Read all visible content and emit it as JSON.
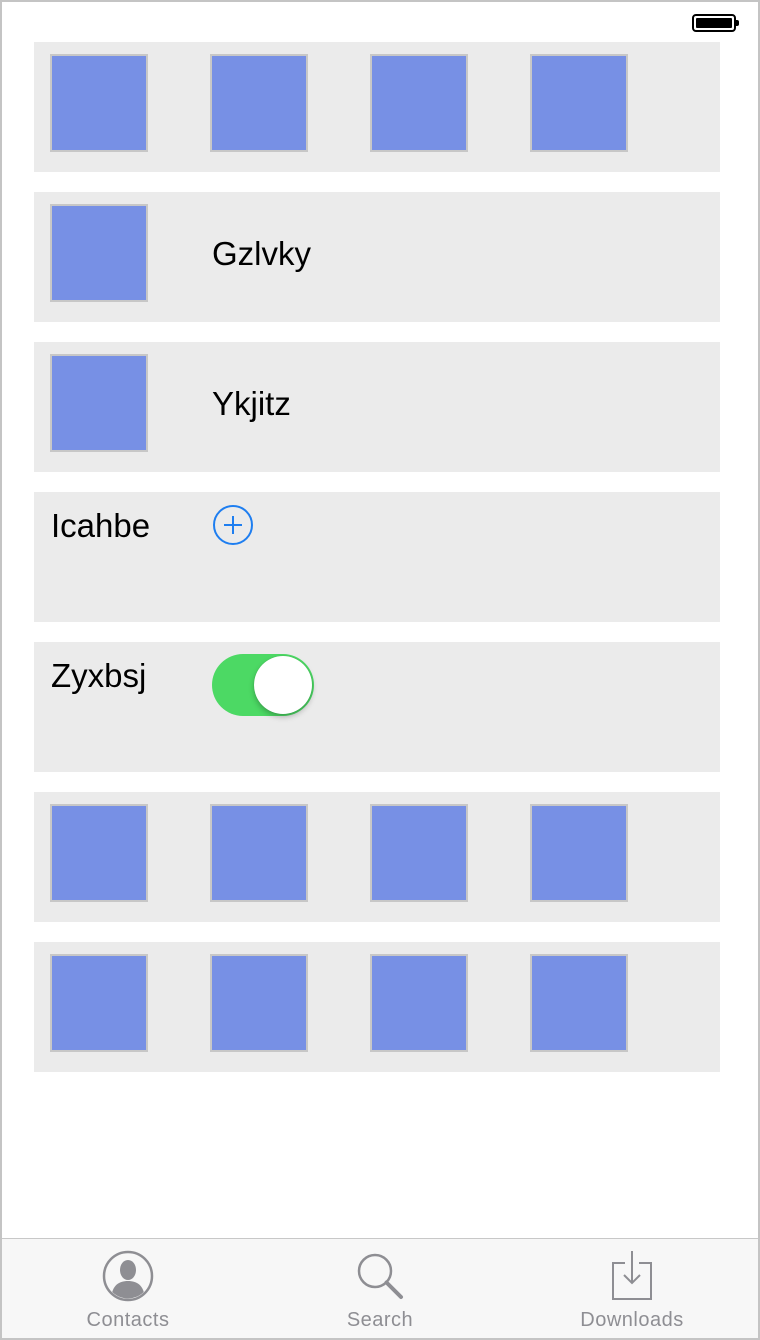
{
  "status_bar": {
    "battery_level": 1.0
  },
  "rows": [
    {
      "type": "image-row",
      "images": 4
    },
    {
      "type": "image-label",
      "label": "Gzlvky"
    },
    {
      "type": "image-label",
      "label": "Ykjitz"
    },
    {
      "type": "label-add",
      "label": "Icahbe",
      "button_icon": "plus-circle-icon"
    },
    {
      "type": "label-toggle",
      "label": "Zyxbsj",
      "toggle_on": true
    },
    {
      "type": "image-row",
      "images": 4
    },
    {
      "type": "image-row",
      "images": 4
    }
  ],
  "colors": {
    "cell_background": "#ebebeb",
    "thumbnail": "#7790e5",
    "accent_blue": "#1e7ef0",
    "toggle_on": "#4cd964",
    "tab_inactive": "#8e8e93"
  },
  "tab_bar": {
    "tabs": [
      {
        "label": "Contacts",
        "icon": "contacts-icon"
      },
      {
        "label": "Search",
        "icon": "search-icon"
      },
      {
        "label": "Downloads",
        "icon": "downloads-icon"
      }
    ]
  }
}
